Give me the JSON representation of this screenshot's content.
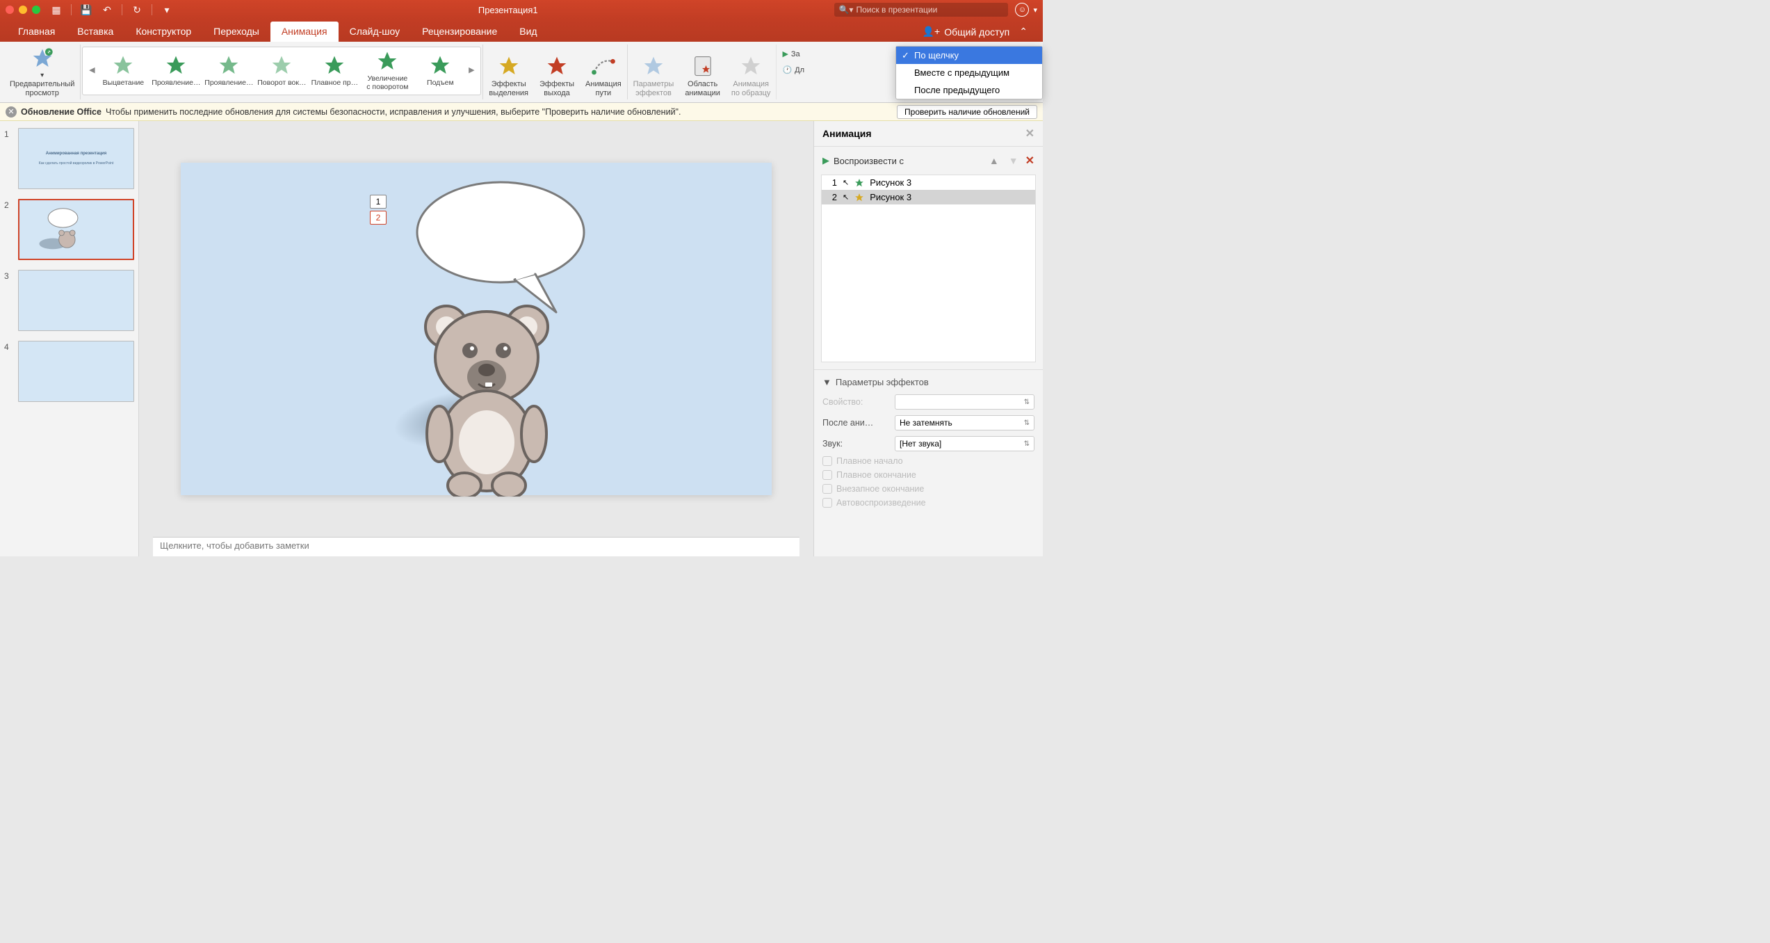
{
  "titlebar": {
    "title": "Презентация1",
    "search_placeholder": "Поиск в презентации"
  },
  "tabs": {
    "items": [
      "Главная",
      "Вставка",
      "Конструктор",
      "Переходы",
      "Анимация",
      "Слайд-шоу",
      "Рецензирование",
      "Вид"
    ],
    "active_index": 4,
    "share_label": "Общий доступ"
  },
  "ribbon": {
    "preview_label": "Предварительный\nпросмотр",
    "gallery_items": [
      "Выцветание",
      "Проявление…",
      "Проявление…",
      "Поворот вок…",
      "Плавное пр…",
      "Увеличение\nс поворотом",
      "Подъем"
    ],
    "emphasis_label": "Эффекты\nвыделения",
    "exit_label": "Эффекты\nвыхода",
    "motion_label": "Анимация\nпути",
    "options_label": "Параметры\nэффектов",
    "pane_label": "Область\nанимации",
    "painter_label": "Анимация\nпо образцу",
    "start_label": "За",
    "duration_label": "Дл",
    "dropdown_items": [
      "По щелчку",
      "Вместе с предыдущим",
      "После предыдущего"
    ],
    "dropdown_selected": 0
  },
  "updatebar": {
    "title": "Обновление Office",
    "text": "Чтобы применить последние обновления для системы безопасности, исправления и улучшения, выберите \"Проверить наличие обновлений\".",
    "button": "Проверить наличие обновлений"
  },
  "thumbs": {
    "slides": [
      {
        "num": "1",
        "title": "Анимированная\nпрезентация",
        "sub": "Как сделать простой видеоролик\nв PowerPoint"
      },
      {
        "num": "2"
      },
      {
        "num": "3"
      },
      {
        "num": "4"
      }
    ],
    "selected": 1
  },
  "canvas": {
    "anim_tags": [
      "1",
      "2"
    ],
    "anim_tag_selected": 1,
    "notes_placeholder": "Щелкните, чтобы добавить заметки"
  },
  "rpane": {
    "title": "Анимация",
    "play_label": "Воспроизвести с",
    "list": [
      {
        "num": "1",
        "type": "entrance",
        "name": "Рисунок 3"
      },
      {
        "num": "2",
        "type": "emphasis",
        "name": "Рисунок 3"
      }
    ],
    "selected": 1,
    "effects_header": "Параметры эффектов",
    "prop_property": "Свойство:",
    "prop_after": "После ани…",
    "prop_after_val": "Не затемнять",
    "prop_sound": "Звук:",
    "prop_sound_val": "[Нет звука]",
    "chk_smooth_start": "Плавное начало",
    "chk_smooth_end": "Плавное окончание",
    "chk_bounce": "Внезапное окончание",
    "chk_auto": "Автовоспроизведение"
  }
}
